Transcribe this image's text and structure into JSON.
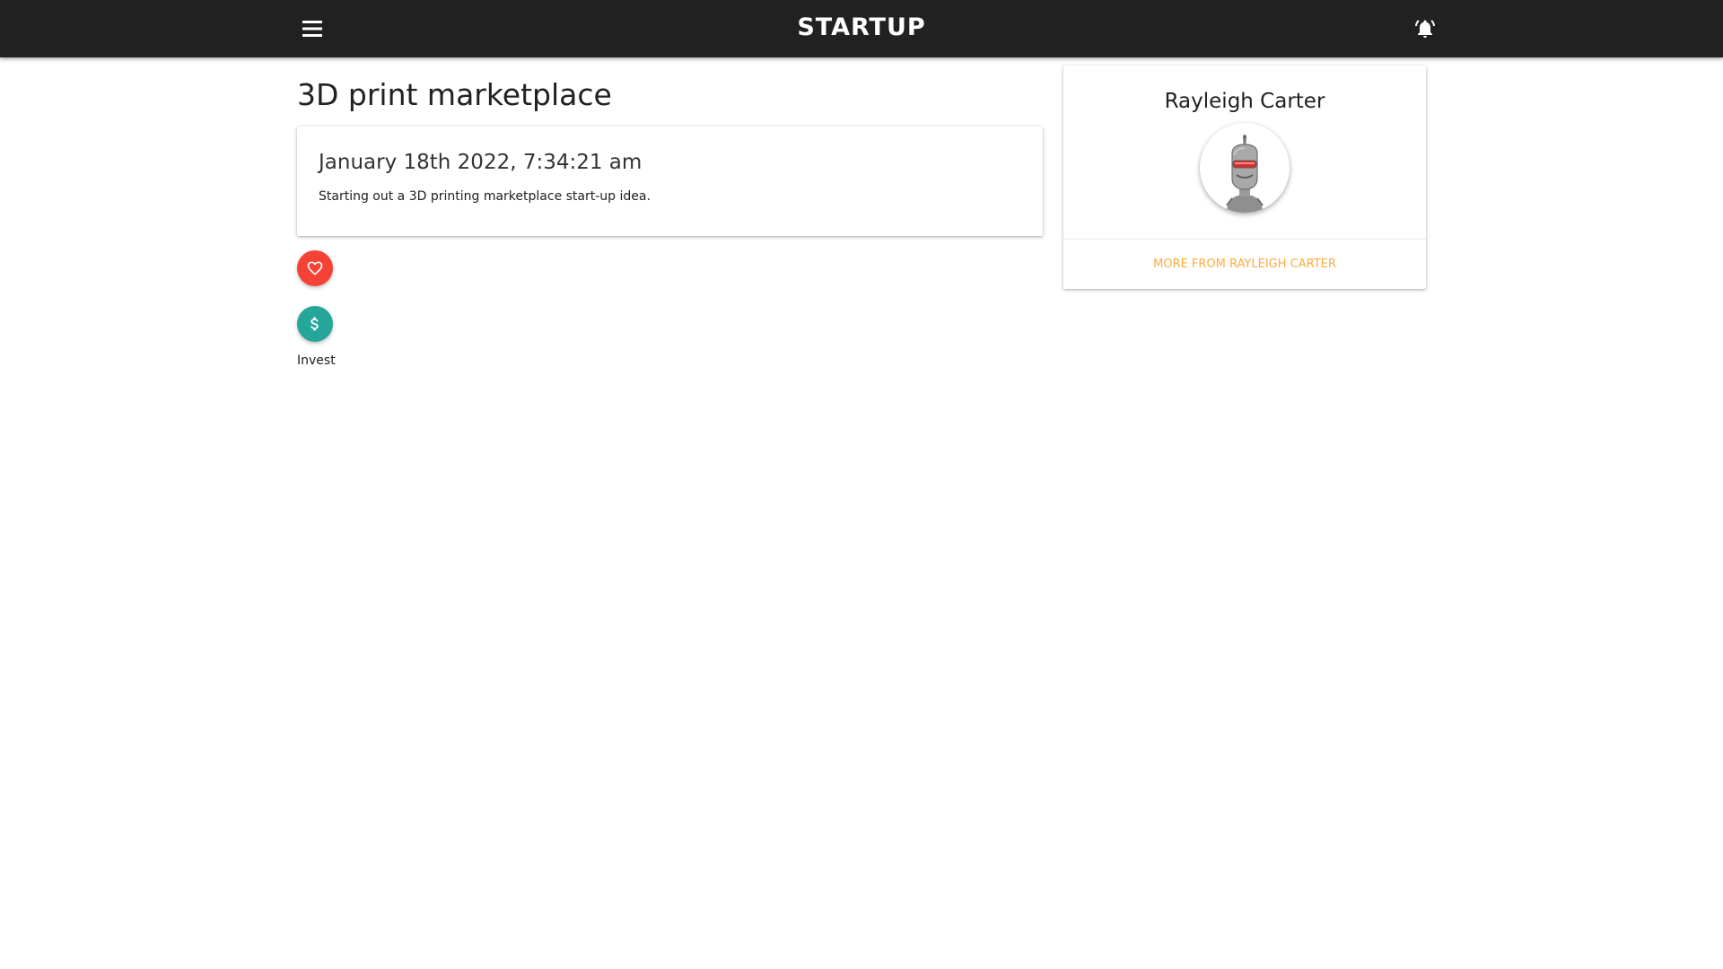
{
  "header": {
    "logo_text": "STARTUP",
    "menu_icon": "hamburger-menu-icon",
    "notification_icon": "bell-icon",
    "background_color": "#212121"
  },
  "post": {
    "title": "3D print marketplace",
    "date": "January 18th 2022, 7:34:21 am",
    "description": "Starting out a 3D printing marketplace start-up idea."
  },
  "actions": {
    "like": {
      "icon": "heart-outline-icon",
      "color": "#f44336"
    },
    "invest": {
      "icon": "dollar-icon",
      "color": "#26a69a",
      "label": "Invest"
    }
  },
  "author": {
    "name": "Rayleigh Carter",
    "avatar_icon": "robot-avatar",
    "more_link": "MORE FROM RAYLEIGH CARTER",
    "link_color": "#ffab40"
  }
}
